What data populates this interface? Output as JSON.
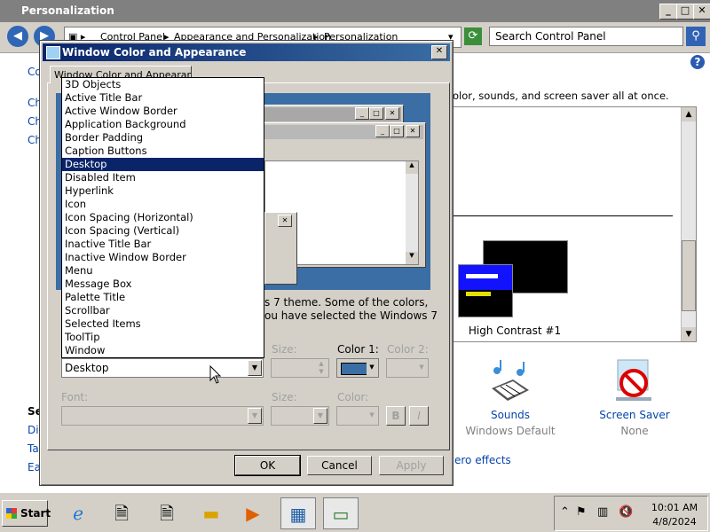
{
  "outer_window": {
    "title": "Personalization",
    "address": {
      "segments": [
        "Control Panel",
        "Appearance and Personalization",
        "Personalization"
      ]
    },
    "search_placeholder": "Search Control Panel"
  },
  "background": {
    "left_partial": [
      "Co",
      "Ch",
      "Ch",
      "Ch"
    ],
    "bottom_partial": [
      "Se",
      "Dis",
      "Ta",
      "Ea"
    ],
    "desc_text": "olor, sounds, and screen saver all at once.",
    "theme_name": "High Contrast #1",
    "sounds_label": "Sounds",
    "sounds_sub": "Windows Default",
    "saver_label": "Screen Saver",
    "saver_sub": "None",
    "aero_link": "ero effects"
  },
  "dialog": {
    "title": "Window Color and Appearance",
    "tab": "Window Color and Appearance",
    "info_line1": "s 7 theme.  Some of the colors,",
    "info_line2": "ou have selected the Windows 7",
    "item_combo_value": "Desktop",
    "size_label": "Size:",
    "color1_label": "Color 1:",
    "color2_label": "Color 2:",
    "font_label": "Font:",
    "font_size_label": "Size:",
    "font_color_label": "Color:",
    "bold_label": "B",
    "italic_label": "I",
    "ok": "OK",
    "cancel": "Cancel",
    "apply": "Apply",
    "color1_value": "#3a6ea5"
  },
  "item_list": {
    "selected": "Desktop",
    "items": [
      "3D Objects",
      "Active Title Bar",
      "Active Window Border",
      "Application Background",
      "Border Padding",
      "Caption Buttons",
      "Desktop",
      "Disabled Item",
      "Hyperlink",
      "Icon",
      "Icon Spacing (Horizontal)",
      "Icon Spacing (Vertical)",
      "Inactive Title Bar",
      "Inactive Window Border",
      "Menu",
      "Message Box",
      "Palette Title",
      "Scrollbar",
      "Selected Items",
      "ToolTip",
      "Window"
    ]
  },
  "taskbar": {
    "start_label": "Start",
    "icons": [
      "internet-explorer-icon",
      "document-icon",
      "document-icon",
      "folder-icon",
      "media-player-icon",
      "control-panel-icon",
      "display-icon"
    ],
    "time": "10:01 AM",
    "date": "4/8/2024"
  }
}
